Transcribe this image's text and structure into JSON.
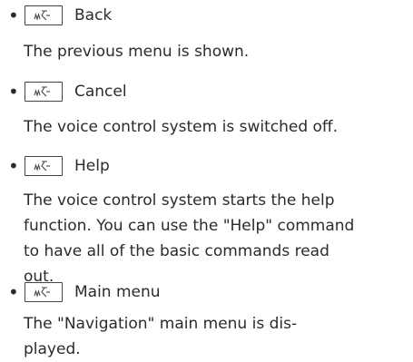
{
  "entries": [
    {
      "command": "Back",
      "description_lines": [
        "The previous menu is shown."
      ]
    },
    {
      "command": "Cancel",
      "description_lines": [
        "The voice control system is switched off."
      ]
    },
    {
      "command": "Help",
      "description_lines": [
        "The voice control system starts the help",
        "function. You can use the \"Help\" command",
        "to have all of the basic commands read",
        "out."
      ]
    },
    {
      "command": "Main menu",
      "description_lines": [
        "The \"Navigation\" main menu is dis-",
        "played."
      ]
    }
  ],
  "bullet_glyph": "•",
  "key_icon": "voice-control-icon"
}
